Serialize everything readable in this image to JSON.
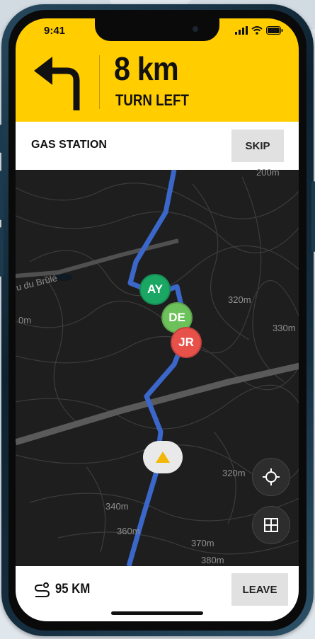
{
  "status": {
    "time": "9:41"
  },
  "navigation": {
    "distance": "8 km",
    "instruction": "TURN LEFT",
    "direction_icon": "turn-left-arrow-icon"
  },
  "waypoint": {
    "name": "GAS STATION",
    "skip_label": "SKIP"
  },
  "map": {
    "street_label": "u du Brûlé",
    "contour_labels": [
      "200m",
      "320m",
      "330m",
      "0m",
      "320m",
      "340m",
      "360m",
      "370m",
      "380m"
    ],
    "members": [
      {
        "initials": "AY",
        "color": "#1aa663"
      },
      {
        "initials": "DE",
        "color": "#6cc15a"
      },
      {
        "initials": "JR",
        "color": "#e8504a"
      }
    ],
    "route_color": "#3a67c9",
    "locate_icon": "crosshair-icon",
    "layers_icon": "grid-icon"
  },
  "footer": {
    "total_distance": "95 KM",
    "route_icon": "route-icon",
    "leave_label": "LEAVE"
  },
  "colors": {
    "accent": "#ffcd00",
    "button_bg": "#e1e1e1"
  }
}
